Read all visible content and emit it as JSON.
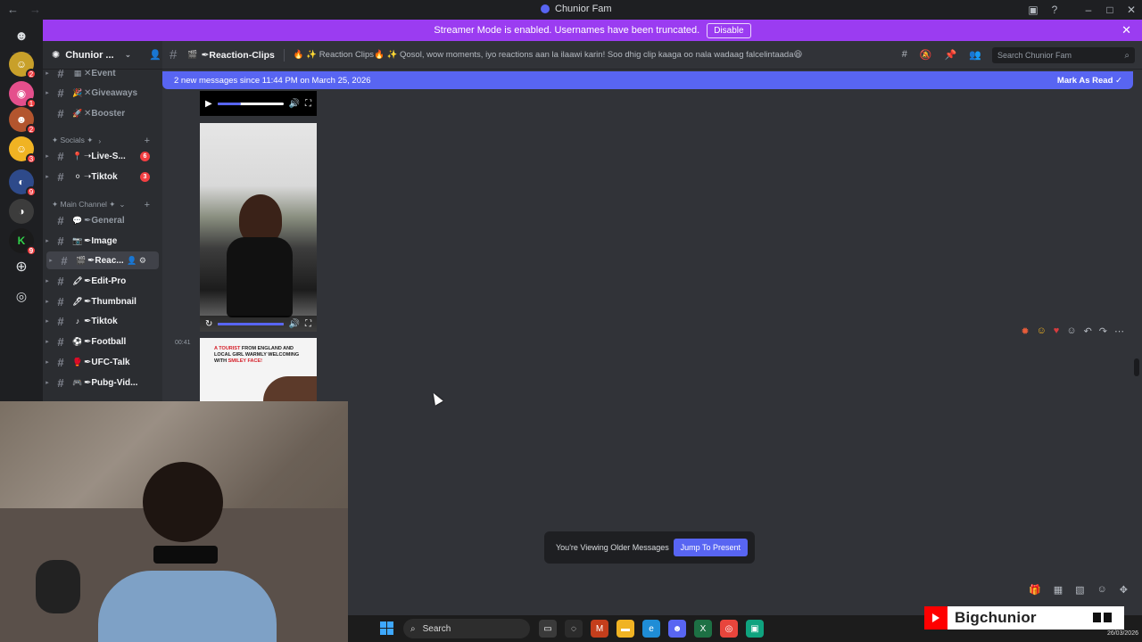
{
  "window": {
    "title": "Chunior Fam"
  },
  "banner": {
    "text": "Streamer Mode is enabled. Usernames have been truncated.",
    "disable_label": "Disable"
  },
  "servers": [
    {
      "name": "discord-home",
      "badge": ""
    },
    {
      "name": "server-1",
      "badge": "2"
    },
    {
      "name": "server-2",
      "badge": "1"
    },
    {
      "name": "server-3",
      "badge": "2"
    },
    {
      "name": "server-4",
      "badge": "3"
    },
    {
      "name": "server-5",
      "badge": "9"
    },
    {
      "name": "server-6",
      "badge": ""
    },
    {
      "name": "server-7",
      "badge": "9"
    }
  ],
  "guild": {
    "name": "Chunior ..."
  },
  "sidebar": {
    "channels_top": [
      {
        "emoji": "▦",
        "name": "✕Event"
      },
      {
        "emoji": "🎉",
        "name": "✕Giveaways"
      },
      {
        "emoji": "🚀",
        "name": "✕Booster"
      }
    ],
    "socials_label": "✦ Socials ✦",
    "socials": [
      {
        "emoji": "📍",
        "name": "➝Live-S...",
        "count": "6"
      },
      {
        "emoji": "⚪",
        "name": "➝Tiktok",
        "count": "3"
      }
    ],
    "main_label": "✦ Main Channel ✦",
    "main": [
      {
        "emoji": "💬",
        "name": "✒General"
      },
      {
        "emoji": "📷",
        "name": "✒Image"
      },
      {
        "emoji": "🎬",
        "name": "✒Reac..."
      },
      {
        "emoji": "🖍",
        "name": "✒Edit-Pro"
      },
      {
        "emoji": "🖊",
        "name": "✒Thumbnail"
      },
      {
        "emoji": "♪",
        "name": "✒Tiktok"
      },
      {
        "emoji": "⚽",
        "name": "✒Football"
      },
      {
        "emoji": "🥊",
        "name": "✒UFC-Talk"
      },
      {
        "emoji": "🎮",
        "name": "✒Pubg-Vid..."
      }
    ]
  },
  "header": {
    "channel_name": "✒Reaction-Clips",
    "topic": "🔥 ✨ Reaction Clips🔥 ✨ Qosol, wow moments, iyo reactions aan la ilaawi karin! Soo dhig clip kaaga oo nala wadaag falcelintaada😆",
    "search_placeholder": "Search Chunior Fam"
  },
  "new_messages": {
    "text": "2 new messages since 11:44 PM on March 25, 2026",
    "mark_read": "Mark As Read"
  },
  "message": {
    "timestamp": "00:41",
    "thumb_caption_pre": "A TOURIST",
    "thumb_caption_mid": " FROM ENGLAND AND LOCAL GIRL WARMLY WELCOMING WITH ",
    "thumb_caption_post": "SMILEY FACE!"
  },
  "older": {
    "text": "You're Viewing Older Messages",
    "jump_label": "Jump To Present"
  },
  "taskbar": {
    "search": "Search",
    "date": "26/03/2026"
  },
  "overlay": {
    "channel_name": "Bigchunior"
  },
  "colors": {
    "accent": "#5865f2",
    "streamer_banner": "#9b3cf1",
    "badge_red": "#f23f42"
  }
}
